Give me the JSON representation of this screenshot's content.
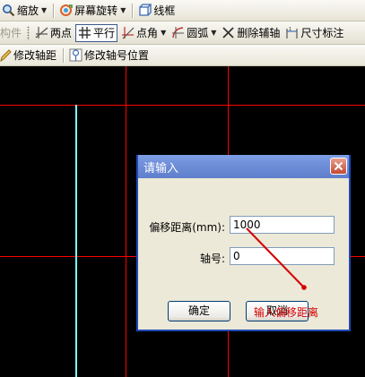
{
  "toolbar1": {
    "zoom_label": "缩放",
    "rotate_label": "屏幕旋转",
    "wireframe_label": "线框"
  },
  "toolbar2": {
    "component_label": "构件",
    "two_point_label": "两点",
    "parallel_label": "平行",
    "point_angle_label": "点角",
    "arc_label": "圆弧",
    "delete_axis_label": "删除辅轴",
    "dimension_label": "尺寸标注"
  },
  "toolbar3": {
    "modify_spacing_label": "修改轴距",
    "modify_axis_no_pos_label": "修改轴号位置"
  },
  "dialog": {
    "title": "请输入",
    "offset_label": "偏移距离(mm):",
    "offset_value": "1000",
    "axis_no_label": "轴号:",
    "axis_no_value": "0",
    "ok_label": "确定",
    "cancel_label": "取消"
  },
  "annotation": {
    "text": "输入偏移距离",
    "color": "#d40000"
  },
  "colors": {
    "canvas_bg": "#000000",
    "grid_line": "#ff0000",
    "selected_axis": "#00ffff",
    "title_bar": "#6f8fd9"
  },
  "icons": {
    "zoom": "magnifier-icon",
    "rotate": "rotate-screen-icon",
    "wireframe": "wireframe-icon",
    "two_point": "two-point-axis-icon",
    "parallel": "parallel-axis-icon",
    "point_angle": "point-angle-icon",
    "arc": "arc-axis-icon",
    "delete_axis": "delete-x-icon",
    "dimension": "dimension-icon",
    "modify_spacing": "pencil-icon",
    "modify_axis_no_pos": "axis-number-icon",
    "close": "close-x-icon"
  }
}
